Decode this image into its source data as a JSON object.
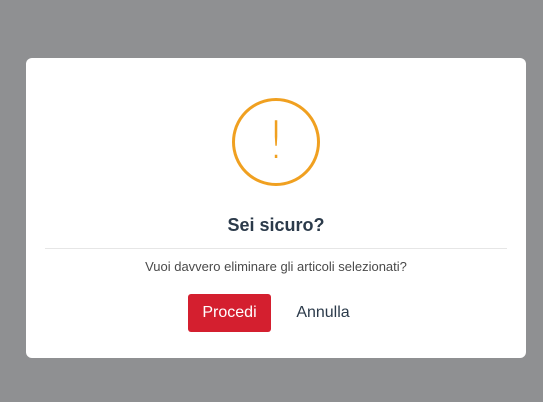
{
  "dialog": {
    "icon": "exclamation-icon",
    "icon_glyph": "!",
    "title": "Sei sicuro?",
    "message": "Vuoi davvero eliminare gli articoli selezionati?",
    "confirm_label": "Procedi",
    "cancel_label": "Annulla"
  },
  "colors": {
    "overlay": "#8f9092",
    "warning": "#f0a020",
    "confirm": "#d41f2f",
    "title_text": "#2b3a4a"
  }
}
